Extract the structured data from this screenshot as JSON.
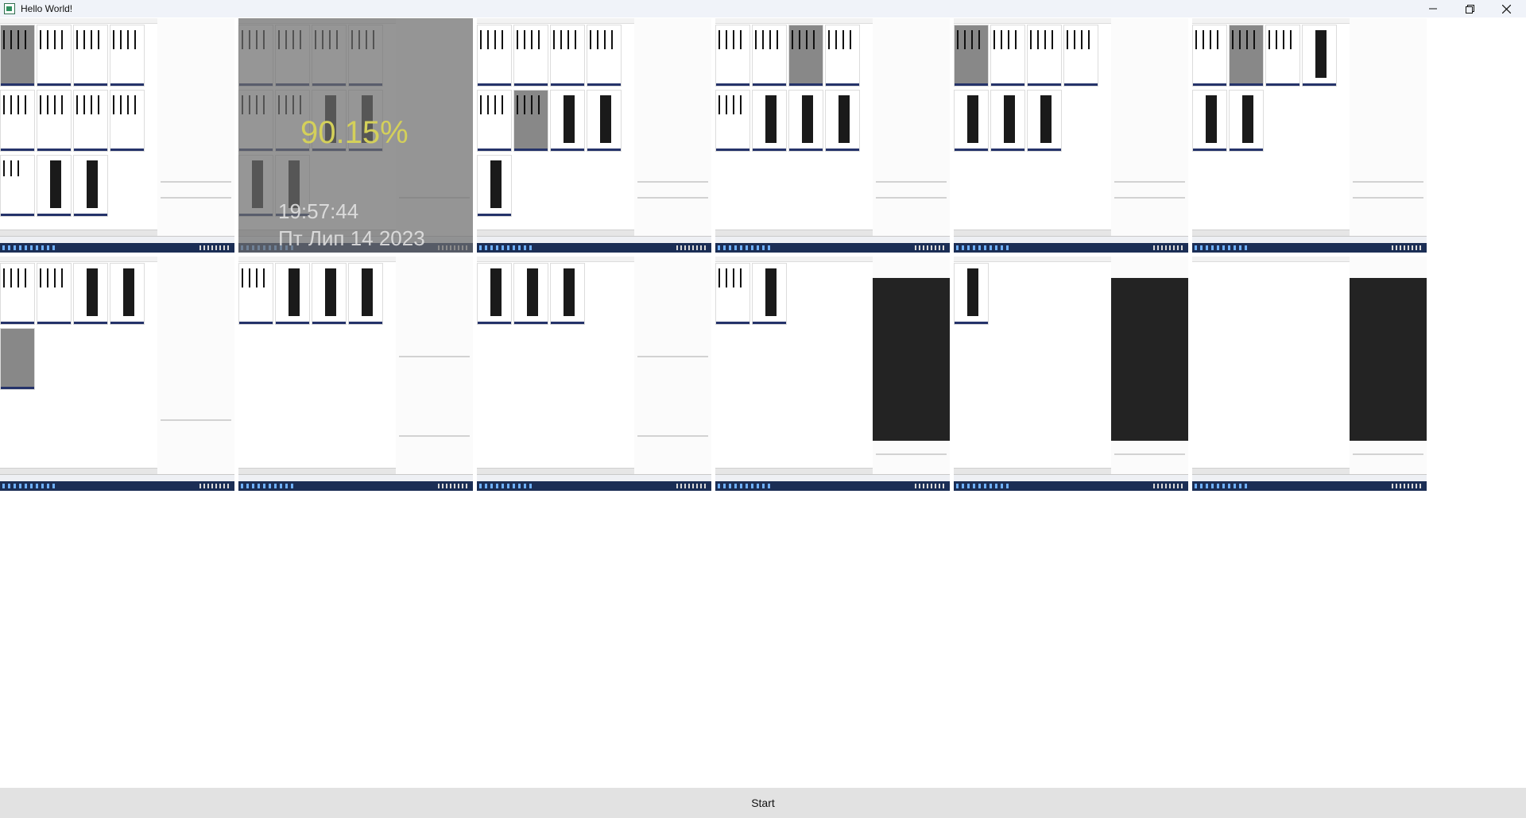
{
  "window": {
    "title": "Hello World!"
  },
  "thumbnails": {
    "featured": {
      "percent": "90.15%",
      "time": "19:57:44",
      "date": "Пт Лип 14 2023"
    }
  },
  "footer": {
    "start_label": "Start"
  },
  "icons": {
    "app": "app-icon",
    "minimize": "minimize-icon",
    "maximize": "restore-icon",
    "close": "close-icon"
  }
}
